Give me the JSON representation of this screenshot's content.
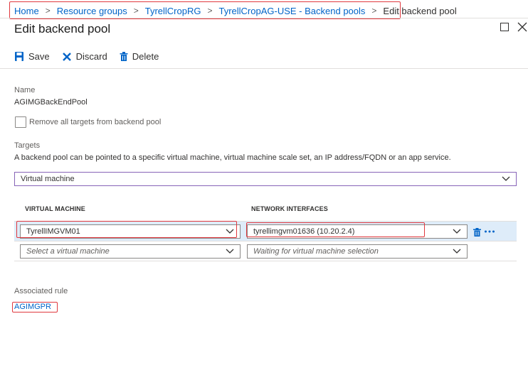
{
  "breadcrumb": {
    "items": [
      "Home",
      "Resource groups",
      "TyrellCropRG",
      "TyrellCropAG-USE - Backend pools"
    ],
    "current": "Edit backend pool"
  },
  "header": {
    "title": "Edit backend pool"
  },
  "toolbar": {
    "save_label": "Save",
    "discard_label": "Discard",
    "delete_label": "Delete"
  },
  "form": {
    "name_label": "Name",
    "name_value": "AGIMGBackEndPool",
    "remove_targets_label": "Remove all targets from backend pool",
    "targets_label": "Targets",
    "targets_description": "A backend pool can be pointed to a specific virtual machine, virtual machine scale set, an IP address/FQDN or an app service.",
    "target_type": "Virtual machine"
  },
  "table": {
    "columns": [
      "VIRTUAL MACHINE",
      "NETWORK INTERFACES"
    ],
    "rows": [
      {
        "vm": "TyrellIMGVM01",
        "nic": "tyrellimgvm01636 (10.20.2.4)"
      }
    ],
    "new_row": {
      "vm_placeholder": "Select a virtual machine",
      "nic_placeholder": "Waiting for virtual machine selection"
    }
  },
  "associated": {
    "label": "Associated rule",
    "rule": "AGIMGPR"
  },
  "colors": {
    "accent": "#0064c8",
    "highlight": "#e0383e",
    "dropdown_active": "#8764b8",
    "row_selected": "#deecf9"
  },
  "icons": [
    "save-icon",
    "discard-icon",
    "delete-icon",
    "maximize-icon",
    "close-icon",
    "chevron-down-icon",
    "trash-icon",
    "more-icon"
  ]
}
